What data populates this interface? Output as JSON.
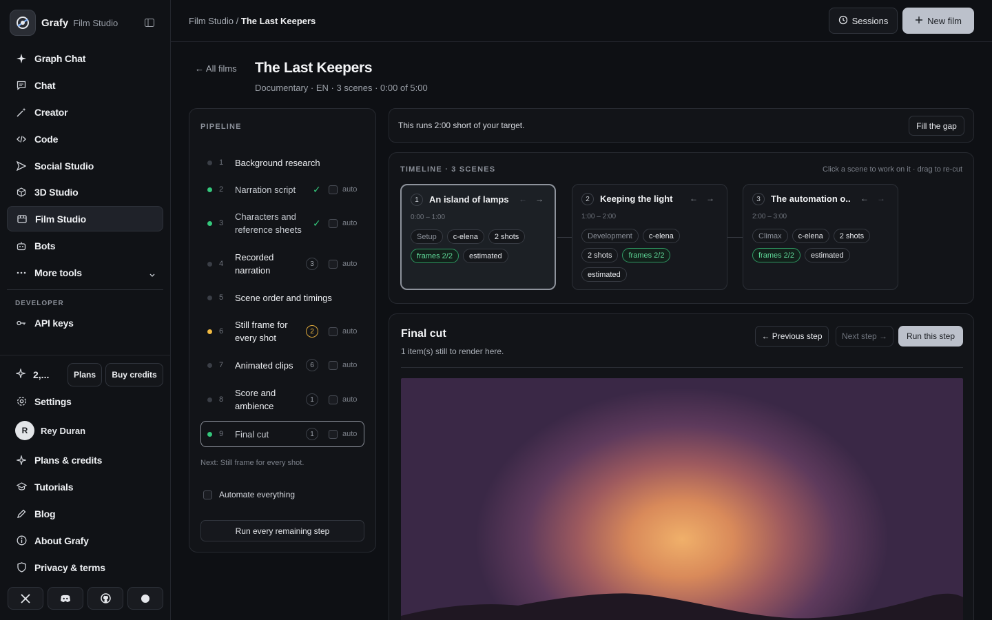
{
  "brand": {
    "name": "Grafy",
    "product": "Film Studio"
  },
  "sidebar": {
    "items": [
      {
        "label": "Graph Chat",
        "icon": "sparkle-icon"
      },
      {
        "label": "Chat",
        "icon": "chat-icon"
      },
      {
        "label": "Creator",
        "icon": "wand-icon"
      },
      {
        "label": "Code",
        "icon": "code-icon"
      },
      {
        "label": "Social Studio",
        "icon": "send-icon"
      },
      {
        "label": "3D Studio",
        "icon": "cube-icon"
      },
      {
        "label": "Film Studio",
        "icon": "film-icon",
        "active": true
      },
      {
        "label": "Bots",
        "icon": "bot-icon"
      },
      {
        "label": "More tools",
        "icon": "ellipsis-icon"
      }
    ],
    "developer_label": "DEVELOPER",
    "api_keys": "API keys",
    "credits_value": "2,...",
    "plans_btn": "Plans",
    "buy_credits_btn": "Buy credits",
    "settings": "Settings",
    "user_name": "Rey Duran",
    "user_initial": "R",
    "bottom_items": [
      "Plans & credits",
      "Tutorials",
      "Blog",
      "About Grafy",
      "Privacy & terms"
    ]
  },
  "topbar": {
    "breadcrumb_parent": "Film Studio",
    "breadcrumb_sep": "/",
    "breadcrumb_current": "The Last Keepers",
    "sessions_label": "Sessions",
    "new_film_label": "New film"
  },
  "film": {
    "back_label": "← All films",
    "title": "The Last Keepers",
    "meta": "Documentary · EN · 3 scenes · 0:00 of 5:00"
  },
  "pipeline": {
    "label": "PIPELINE",
    "steps": [
      {
        "n": "1",
        "name": "Background research"
      },
      {
        "n": "2",
        "name": "Narration script",
        "check": "✓",
        "auto": "auto"
      },
      {
        "n": "3",
        "name": "Characters and reference sheets",
        "check": "✓",
        "auto": "auto"
      },
      {
        "n": "4",
        "name": "Recorded narration",
        "badge": "3",
        "auto": "auto"
      },
      {
        "n": "5",
        "name": "Scene order and timings"
      },
      {
        "n": "6",
        "name": "Still frame for every shot",
        "badge": "2",
        "auto": "auto"
      },
      {
        "n": "7",
        "name": "Animated clips",
        "badge": "6",
        "auto": "auto"
      },
      {
        "n": "8",
        "name": "Score and ambience",
        "badge": "1",
        "auto": "auto"
      },
      {
        "n": "9",
        "name": "Final cut",
        "badge": "1",
        "auto": "auto"
      }
    ],
    "next_hint": "Next: Still frame for every shot.",
    "automate_label": "Automate everything",
    "run_all_label": "Run every remaining step"
  },
  "notice": {
    "text": "This runs 2:00 short of your target.",
    "button": "Fill the gap"
  },
  "timeline": {
    "label": "TIMELINE · 3 SCENES",
    "hint": "Click a scene to work on it · drag to re-cut",
    "scenes": [
      {
        "n": "1",
        "title": "An island of lamps",
        "time": "0:00 – 1:00",
        "tags": [
          "Setup",
          "c-elena",
          "2 shots",
          "frames 2/2",
          "estimated"
        ]
      },
      {
        "n": "2",
        "title": "Keeping the light",
        "time": "1:00 – 2:00",
        "tags": [
          "Development",
          "c-elena",
          "2 shots",
          "frames 2/2",
          "estimated"
        ]
      },
      {
        "n": "3",
        "title": "The automation o...",
        "time": "2:00 – 3:00",
        "tags": [
          "Climax",
          "c-elena",
          "2 shots",
          "frames 2/2",
          "estimated"
        ]
      }
    ],
    "arrow_left": "←",
    "arrow_right": "→"
  },
  "final_cut": {
    "title": "Final cut",
    "subtitle": "1 item(s) still to render here.",
    "prev_label": "← Previous step",
    "next_label": "Next step →",
    "run_label": "Run this step"
  }
}
